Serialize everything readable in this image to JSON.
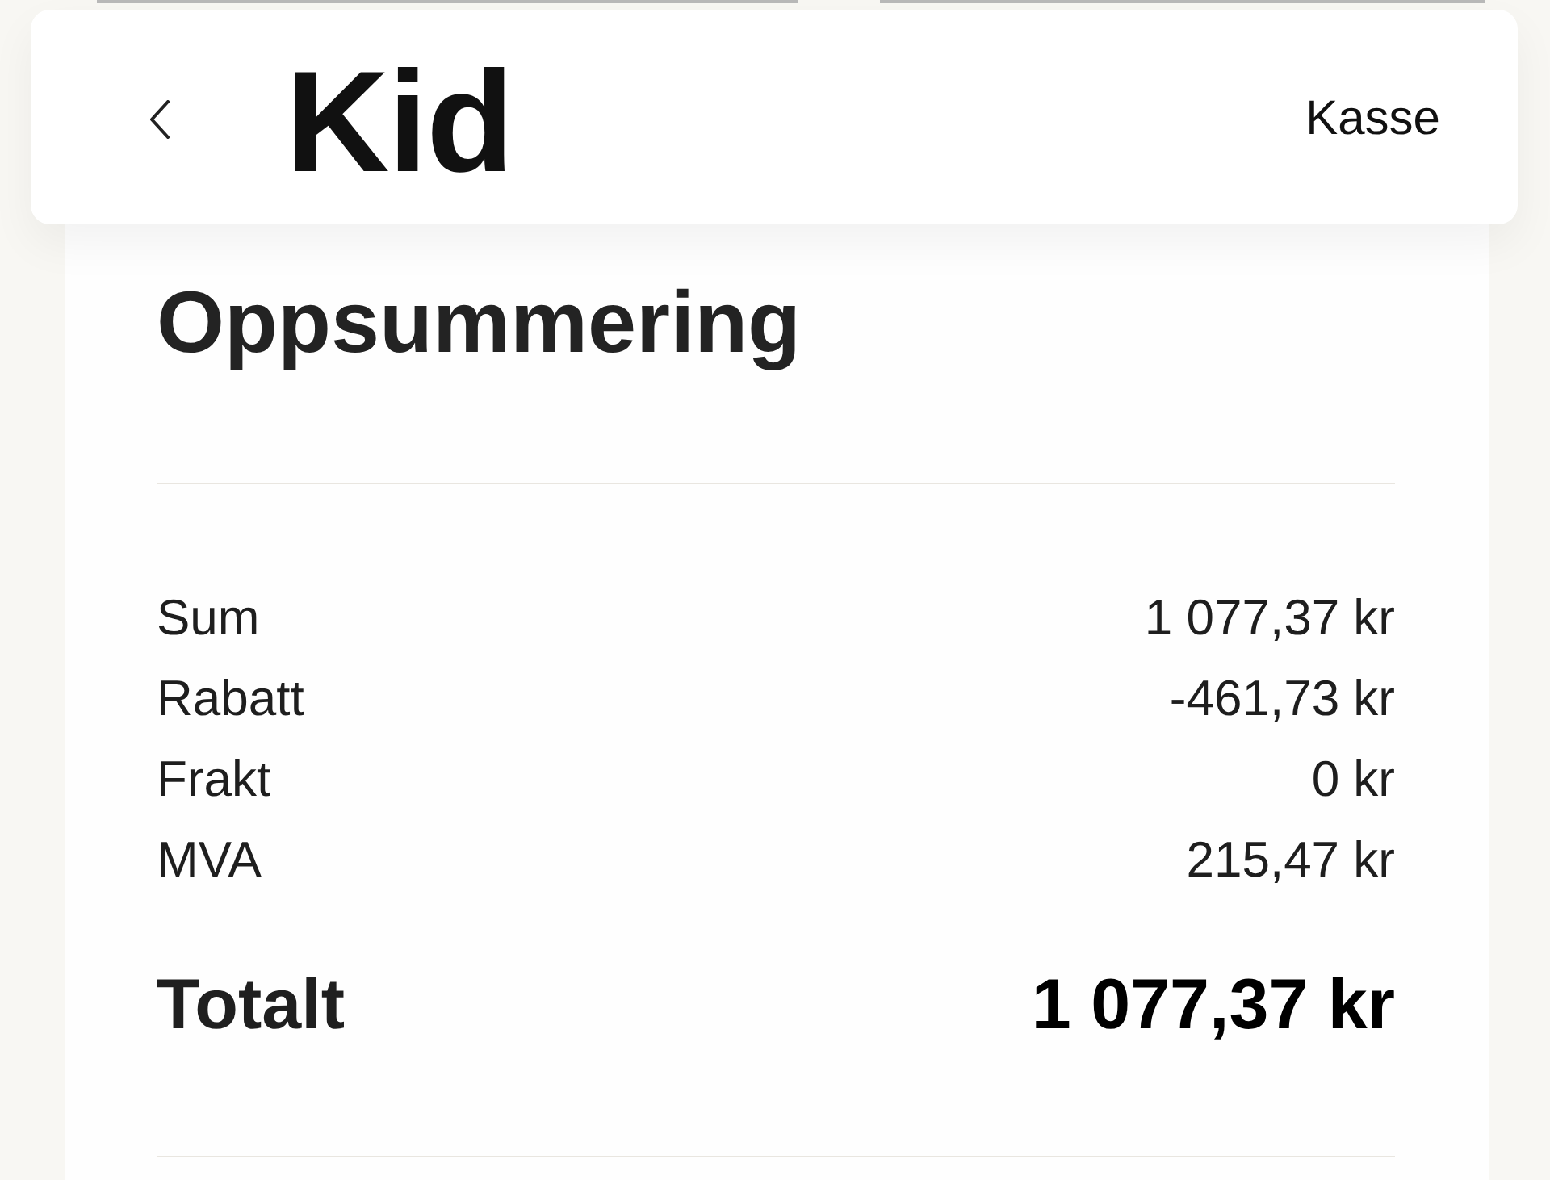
{
  "header": {
    "logo": "Kid",
    "title": "Kasse"
  },
  "summary": {
    "title": "Oppsummering",
    "rows": [
      {
        "label": "Sum",
        "value": "1 077,37 kr"
      },
      {
        "label": "Rabatt",
        "value": "-461,73 kr"
      },
      {
        "label": "Frakt",
        "value": "0 kr"
      },
      {
        "label": "MVA",
        "value": "215,47 kr"
      }
    ],
    "total": {
      "label": "Totalt",
      "value": "1 077,37 kr"
    }
  }
}
